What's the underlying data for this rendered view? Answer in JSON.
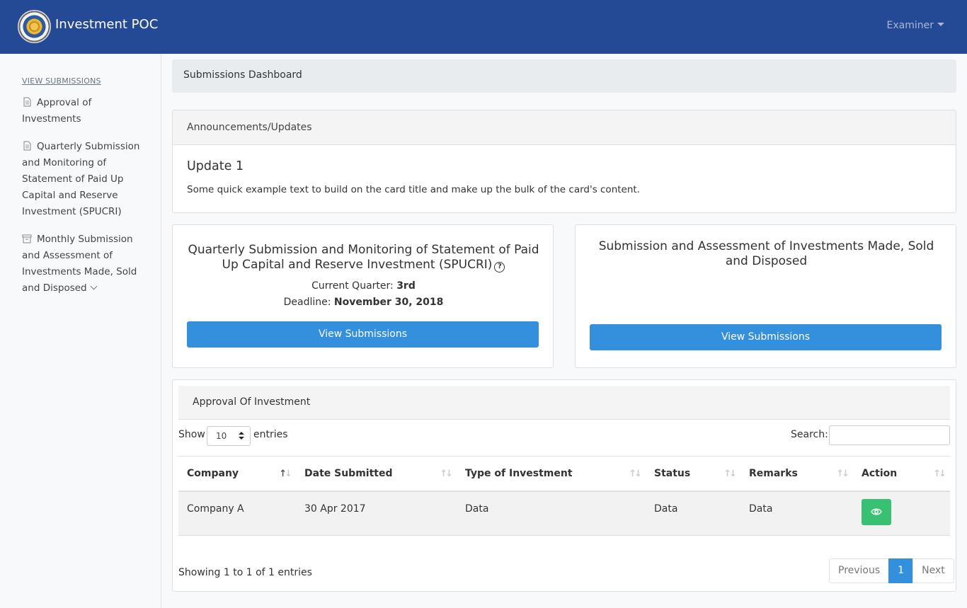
{
  "navbar": {
    "title": "Investment POC",
    "user_menu_label": "Examiner"
  },
  "sidebar": {
    "heading": "VIEW SUBMISSIONS",
    "items": [
      {
        "label": "Approval of Investments",
        "icon": "document-icon"
      },
      {
        "label": "Quarterly Submission and Monitoring of Statement of Paid Up Capital and Reserve Investment (SPUCRI)",
        "icon": "document-icon"
      },
      {
        "label": "Monthly Submission and Assessment of Investments Made, Sold and Disposed",
        "icon": "archive-icon"
      }
    ]
  },
  "breadcrumb": {
    "current": "Submissions Dashboard"
  },
  "announcements": {
    "header": "Announcements/Updates",
    "title": "Update 1",
    "text": "Some quick example text to build on the card title and make up the bulk of the card's content."
  },
  "card_spucri": {
    "title": "Quarterly Submission and Monitoring of Statement of Paid Up Capital and Reserve Investment (SPUCRI)",
    "quarter_label": "Current Quarter:",
    "quarter_value": "3rd",
    "deadline_label": "Deadline:",
    "deadline_value": "November 30, 2018",
    "button_label": "View Submissions"
  },
  "card_investments": {
    "title": "Submission and Assessment of Investments Made, Sold and Disposed",
    "button_label": "View Submissions"
  },
  "table_card": {
    "header": "Approval Of Investment",
    "show_label": "Show",
    "entries_value": "10",
    "entries_label": "entries",
    "search_label": "Search:",
    "search_value": "",
    "columns": [
      "Company",
      "Date Submitted",
      "Type of Investment",
      "Status",
      "Remarks",
      "Action"
    ],
    "rows": [
      {
        "company": "Company A",
        "date": "30 Apr 2017",
        "type": "Data",
        "status": "Data",
        "remarks": "Data",
        "action_icon": "eye-icon"
      }
    ],
    "info": "Showing 1 to 1 of 1 entries",
    "pagination": {
      "previous": "Previous",
      "current": "1",
      "next": "Next"
    }
  },
  "colors": {
    "navbar": "#244a95",
    "primary": "#3490dc",
    "success": "#38c172"
  }
}
